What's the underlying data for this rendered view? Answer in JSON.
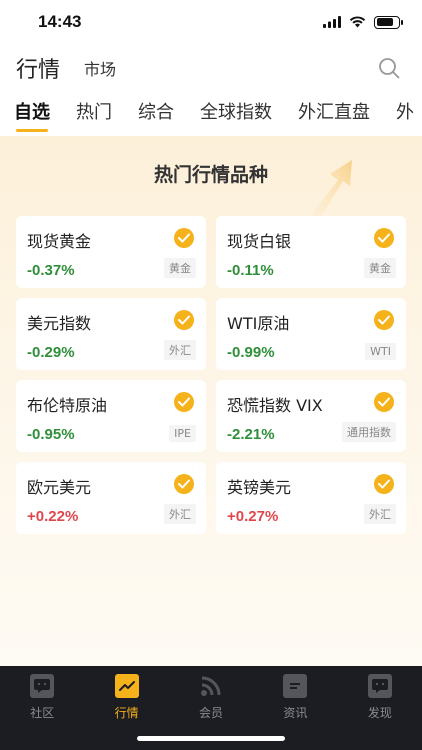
{
  "status": {
    "time": "14:43"
  },
  "header": {
    "title": "行情",
    "subtitle": "市场"
  },
  "tabs": [
    {
      "label": "自选",
      "active": true
    },
    {
      "label": "热门"
    },
    {
      "label": "综合"
    },
    {
      "label": "全球指数"
    },
    {
      "label": "外汇直盘"
    },
    {
      "label": "外"
    }
  ],
  "panel": {
    "title": "热门行情品种",
    "cards": [
      {
        "name": "现货黄金",
        "change": "-0.37%",
        "direction": "down",
        "tag": "黄金"
      },
      {
        "name": "现货白银",
        "change": "-0.11%",
        "direction": "down",
        "tag": "黄金"
      },
      {
        "name": "美元指数",
        "change": "-0.29%",
        "direction": "down",
        "tag": "外汇"
      },
      {
        "name": "WTI原油",
        "change": "-0.99%",
        "direction": "down",
        "tag": "WTI"
      },
      {
        "name": "布伦特原油",
        "change": "-0.95%",
        "direction": "down",
        "tag": "IPE"
      },
      {
        "name": "恐慌指数 VIX",
        "change": "-2.21%",
        "direction": "down",
        "tag": "通用指数"
      },
      {
        "name": "欧元美元",
        "change": "+0.22%",
        "direction": "up",
        "tag": "外汇"
      },
      {
        "name": "英镑美元",
        "change": "+0.27%",
        "direction": "up",
        "tag": "外汇"
      }
    ]
  },
  "tabbar": [
    {
      "label": "社区",
      "icon": "chat-icon"
    },
    {
      "label": "行情",
      "icon": "chart-icon",
      "active": true
    },
    {
      "label": "会员",
      "icon": "rss-icon"
    },
    {
      "label": "资讯",
      "icon": "news-icon"
    },
    {
      "label": "发现",
      "icon": "discover-icon"
    }
  ],
  "colors": {
    "accent": "#f5b21b",
    "down": "#2f8f3a",
    "up": "#e0474c",
    "tabbar_bg": "#1c1d23"
  }
}
